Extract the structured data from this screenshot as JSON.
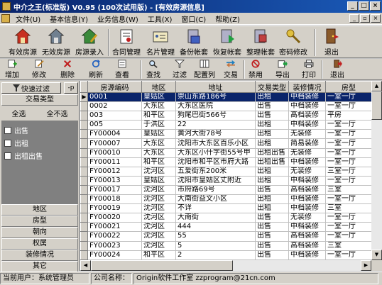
{
  "window": {
    "title": "中介之王(标准版) V0.95 (100次试用版) - [有效房源信息]"
  },
  "menu": [
    "文件(U)",
    "基本信息(Y)",
    "业务信息(W)",
    "工具(X)",
    "窗口(C)",
    "帮助(Z)"
  ],
  "toolbar1": [
    {
      "label": "有效房源",
      "icon": "house-icon"
    },
    {
      "label": "无效房源",
      "icon": "house-icon"
    },
    {
      "label": "房源录入",
      "icon": "house-pen-icon"
    },
    {
      "label": "合同管理",
      "icon": "contract-icon"
    },
    {
      "label": "名片管理",
      "icon": "card-icon"
    },
    {
      "label": "备份帐套",
      "icon": "backup-icon"
    },
    {
      "label": "恢复帐套",
      "icon": "restore-icon"
    },
    {
      "label": "整理帐套",
      "icon": "organize-icon"
    },
    {
      "label": "密码修改",
      "icon": "key-icon"
    },
    {
      "label": "退出",
      "icon": "exit-door-icon"
    }
  ],
  "toolbar2": [
    {
      "label": "增加",
      "icon": "add-icon"
    },
    {
      "label": "修改",
      "icon": "edit-icon"
    },
    {
      "label": "删除",
      "icon": "delete-icon"
    },
    {
      "label": "刷新",
      "icon": "refresh-icon"
    },
    {
      "label": "查看",
      "icon": "view-icon"
    },
    {
      "label": "查找",
      "icon": "find-icon"
    },
    {
      "label": "过滤",
      "icon": "filter-icon"
    },
    {
      "label": "配置列",
      "icon": "columns-icon"
    },
    {
      "label": "交易",
      "icon": "trade-icon"
    },
    {
      "label": "禁用",
      "icon": "disable-icon"
    },
    {
      "label": "导出",
      "icon": "export-icon"
    },
    {
      "label": "打印",
      "icon": "print-icon"
    },
    {
      "label": "退出",
      "icon": "exit-icon"
    }
  ],
  "filter": {
    "quick_filter": "快速过滤",
    "pin": "-p",
    "category": "交易类型",
    "select_all": "全选",
    "select_none": "全不选",
    "options": [
      "出售",
      "出租",
      "出租出售"
    ],
    "groups": [
      "地区",
      "房型",
      "朝向",
      "权属",
      "装修情况",
      "其它"
    ]
  },
  "table": {
    "columns": [
      "房源编码",
      "地区",
      "地址",
      "交易类型",
      "装修情况",
      "房型"
    ],
    "rows": [
      [
        "0001",
        "皇姑区",
        "崇山东路186号",
        "出租",
        "中档装修",
        "一室一厅"
      ],
      [
        "0002",
        "大东区",
        "大东区医院",
        "出售",
        "中档装修",
        "一室一厅"
      ],
      [
        "003",
        "和平区",
        "狗尾巴街566号",
        "出售",
        "高档装修",
        "平房"
      ],
      [
        "005",
        "于洪区",
        "22",
        "出租",
        "中档装修",
        "一室一厅"
      ],
      [
        "FY00004",
        "皇姑区",
        "黄河大街78号",
        "出租",
        "无装修",
        "一室一厅"
      ],
      [
        "FY00007",
        "大东区",
        "沈阳市大东区百乐小区",
        "出租",
        "简易装修",
        "一室一厅"
      ],
      [
        "FY00010",
        "大东区",
        "大东区小什字街55号甲",
        "出租出售",
        "无装修",
        "一室一厅"
      ],
      [
        "FY00011",
        "和平区",
        "沈阳市和平区市府大路",
        "出租出售",
        "中档装修",
        "一室一厅"
      ],
      [
        "FY00012",
        "沈河区",
        "五爱街东200米",
        "出租",
        "无装修",
        "三室一厅"
      ],
      [
        "FY00013",
        "皇姑区",
        "沈阳市皇姑区丈附近",
        "出租",
        "中档装修",
        "一室一厅"
      ],
      [
        "FY00017",
        "沈河区",
        "市府路69号",
        "出售",
        "高档装修",
        "三室"
      ],
      [
        "FY00018",
        "沈河区",
        "大南街益文小区",
        "出租",
        "中档装修",
        "一室一厅"
      ],
      [
        "FY00019",
        "沈河区",
        "不详",
        "出租",
        "中档装修",
        "三室"
      ],
      [
        "FY00020",
        "沈河区",
        "大南街",
        "出售",
        "无装修",
        "一室一厅"
      ],
      [
        "FY00021",
        "沈河区",
        "444",
        "出售",
        "中档装修",
        "一室一厅"
      ],
      [
        "FY00022",
        "沈河区",
        "55",
        "出售",
        "高档装修",
        "一室一厅"
      ],
      [
        "FY00023",
        "沈河区",
        "5",
        "出售",
        "高档装修",
        "三室"
      ],
      [
        "FY00024",
        "和平区",
        "2",
        "出售",
        "中档装修",
        "一室一厅"
      ]
    ]
  },
  "status": {
    "user": "当前用户：系统管理员",
    "company_label": "公司名称：",
    "company": "Origin软件工作室 zzprogram@21cn.com"
  }
}
